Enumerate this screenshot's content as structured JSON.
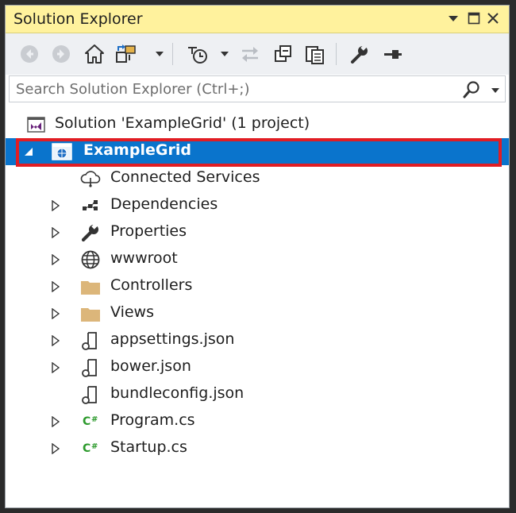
{
  "window": {
    "title": "Solution Explorer",
    "controls": [
      "dropdown-arrow",
      "maximize",
      "close"
    ]
  },
  "toolbar": {
    "buttons": [
      "back-icon",
      "forward-icon",
      "home-icon",
      "switch-views-icon",
      "pending-changes-filter-icon",
      "sync-icon",
      "collapse-all-icon",
      "show-all-files-icon",
      "properties-icon",
      "preview-icon"
    ]
  },
  "search": {
    "placeholder": "Search Solution Explorer (Ctrl+;)"
  },
  "tree": {
    "solution": "Solution 'ExampleGrid' (1 project)",
    "project": "ExampleGrid",
    "items": [
      {
        "label": "Connected Services",
        "icon": "cloud-icon",
        "expandable": false
      },
      {
        "label": "Dependencies",
        "icon": "dependencies-icon",
        "expandable": true
      },
      {
        "label": "Properties",
        "icon": "wrench-icon",
        "expandable": true
      },
      {
        "label": "wwwroot",
        "icon": "globe-icon",
        "expandable": true
      },
      {
        "label": "Controllers",
        "icon": "folder-icon",
        "expandable": true
      },
      {
        "label": "Views",
        "icon": "folder-icon",
        "expandable": true
      },
      {
        "label": "appsettings.json",
        "icon": "json-file-icon",
        "expandable": true
      },
      {
        "label": "bower.json",
        "icon": "json-file-icon",
        "expandable": true
      },
      {
        "label": "bundleconfig.json",
        "icon": "json-file-icon",
        "expandable": false
      },
      {
        "label": "Program.cs",
        "icon": "csharp-file-icon",
        "expandable": true
      },
      {
        "label": "Startup.cs",
        "icon": "csharp-file-icon",
        "expandable": true
      }
    ]
  },
  "colors": {
    "titlebar": "#fff29d",
    "selection": "#0a74cc",
    "highlight_border": "#e11d23",
    "csharp_green": "#2c9a2c",
    "folder": "#dcb67a"
  }
}
